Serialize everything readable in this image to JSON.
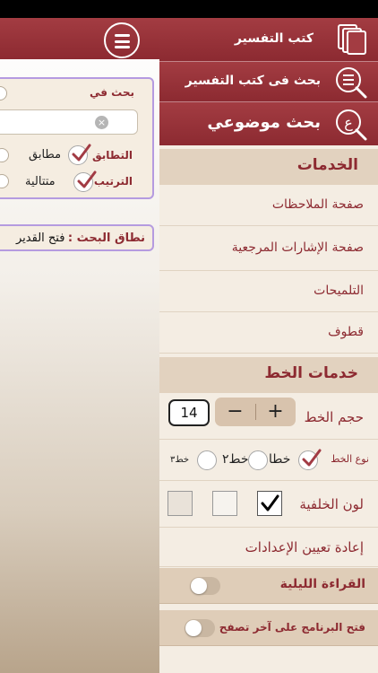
{
  "main": {
    "search_in_label": "بحث في",
    "match_label": "التطابق",
    "match_option": "مطابق",
    "order_label": "الترتيب",
    "order_option": "متتالية",
    "clear_symbol": "×",
    "scope_label": "نطاق البحث :",
    "scope_value": "فتح القدير"
  },
  "menu": {
    "tafsir_books": "كتب التفسير",
    "search_in_tafsir": "بحث فى كتب التفسير",
    "topic_search": "بحث  موضوعي",
    "services_header": "الخدمات",
    "services": [
      "صفحة الملاحظات",
      "صفحة الإشارات المرجعية",
      "التلميحات",
      "قطوف"
    ],
    "font_header": "خدمات الخط",
    "font_size_label": "حجم الخط",
    "font_size_value": "14",
    "stepper_minus": "−",
    "stepper_plus": "+",
    "font_type_label": "نوع الخط",
    "font_types": [
      "خطا",
      "خط٢",
      "خط٣"
    ],
    "bg_color_label": "لون الخلفية",
    "bg_swatches": [
      "#ffffff",
      "#f6f3ee",
      "#e9e2d9"
    ],
    "reset_settings": "إعادة تعيين  الإعدادات",
    "night_reading": "القراءة الليلية",
    "open_last": "فتح البرنامج على آخر تصفح"
  },
  "colors": {
    "brand": "#8d2a31",
    "check": "#a23b44",
    "section_bg": "#e2d2bf",
    "panel_bg": "#f4ede3"
  }
}
